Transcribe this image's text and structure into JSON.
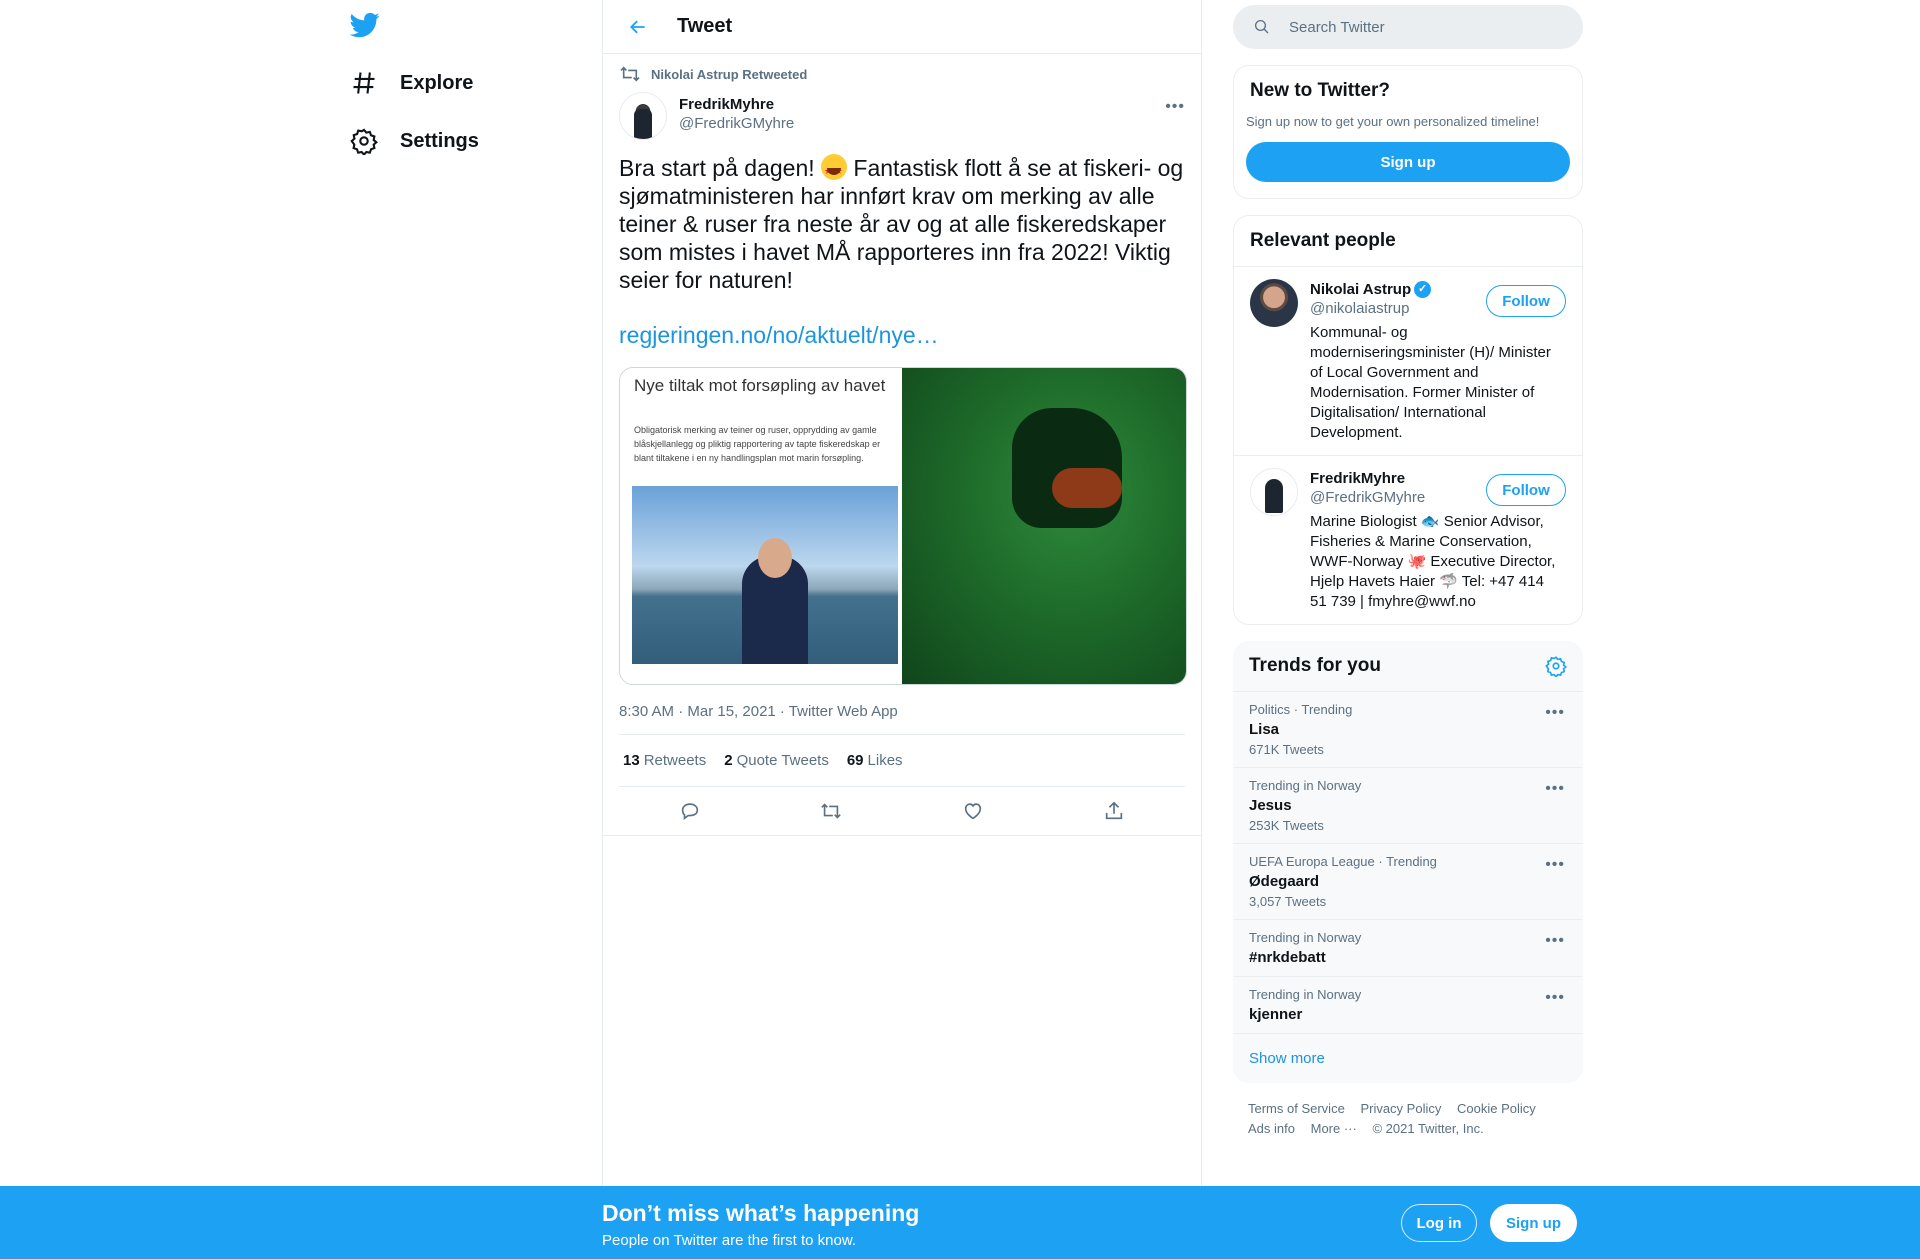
{
  "colors": {
    "accent": "#1da1f2",
    "link": "#1b95e0",
    "muted": "#5b7083"
  },
  "nav": {
    "items": [
      {
        "label": "Explore",
        "icon": "hashtag-icon"
      },
      {
        "label": "Settings",
        "icon": "gear-icon"
      }
    ]
  },
  "header": {
    "title": "Tweet"
  },
  "tweet": {
    "retweet_by": "Nikolai Astrup Retweeted",
    "author_name": "FredrikMyhre",
    "author_handle": "@FredrikGMyhre",
    "text_before_emoji": "Bra start på dagen! ",
    "text_after_emoji": " Fantastisk flott å se at fiskeri- og sjømatministeren har innført krav om merking av alle teiner & ruser fra neste år av og at alle fiskeredskaper som mistes i havet MÅ rapporteres inn fra 2022! Viktig seier for naturen!",
    "link": "regjeringen.no/no/aktuelt/nye…",
    "media_title": "Nye tiltak mot forsøpling av havet",
    "media_subtitle": "Obligatorisk merking av teiner og ruser, opprydding av gamle blåskjellanlegg og pliktig rapportering av tapte fiskeredskap er blant tiltakene i en ny handlingsplan mot marin forsøpling.",
    "meta": "8:30 AM · Mar 15, 2021 · Twitter Web App",
    "retweets_count": "13",
    "retweets_label": "Retweets",
    "quotes_count": "2",
    "quotes_label": "Quote Tweets",
    "likes_count": "69",
    "likes_label": "Likes"
  },
  "search": {
    "placeholder": "Search Twitter"
  },
  "new_to_twitter": {
    "title": "New to Twitter?",
    "subtitle": "Sign up now to get your own personalized timeline!",
    "button": "Sign up"
  },
  "relevant": {
    "title": "Relevant people",
    "people": [
      {
        "name": "Nikolai Astrup",
        "handle": "@nikolaiastrup",
        "bio": "Kommunal- og moderniseringsminister (H)/ Minister of Local Government and Modernisation. Former Minister of Digitalisation/ International Development.",
        "button": "Follow"
      },
      {
        "name": "FredrikMyhre",
        "handle": "@FredrikGMyhre",
        "bio": "Marine Biologist 🐟 Senior Advisor, Fisheries & Marine Conservation, WWF-Norway 🐙 Executive Director, Hjelp Havets Haier 🦈 Tel: +47 414 51 739 | fmyhre@wwf.no",
        "button": "Follow"
      }
    ]
  },
  "trends": {
    "title": "Trends for you",
    "items": [
      {
        "context": "Politics · Trending",
        "name": "Lisa",
        "count": "671K Tweets"
      },
      {
        "context": "Trending in Norway",
        "name": "Jesus",
        "count": "253K Tweets"
      },
      {
        "context": "UEFA Europa League · Trending",
        "name": "Ødegaard",
        "count": "3,057 Tweets"
      },
      {
        "context": "Trending in Norway",
        "name": "#nrkdebatt",
        "count": ""
      },
      {
        "context": "Trending in Norway",
        "name": "kjenner",
        "count": ""
      }
    ],
    "show_more": "Show more"
  },
  "footer": {
    "links": [
      "Terms of Service",
      "Privacy Policy",
      "Cookie Policy",
      "Ads info",
      "More ···",
      "© 2021 Twitter, Inc."
    ]
  },
  "bottom_bar": {
    "title": "Don’t miss what’s happening",
    "subtitle": "People on Twitter are the first to know.",
    "login": "Log in",
    "signup": "Sign up"
  }
}
